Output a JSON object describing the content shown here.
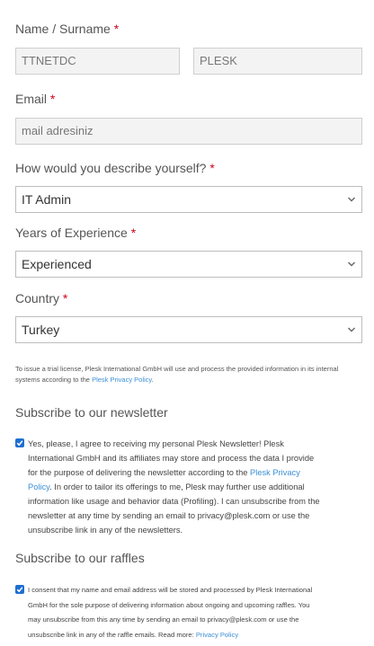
{
  "form": {
    "name_label": "Name / Surname",
    "required_mark": "*",
    "first_name_value": "TTNETDC",
    "last_name_value": "PLESK",
    "email_label": "Email",
    "email_placeholder": "mail adresiniz",
    "describe_label": "How would you describe yourself?",
    "describe_selected": "IT Admin",
    "experience_label": "Years of Experience",
    "experience_selected": "Experienced",
    "country_label": "Country",
    "country_selected": "Turkey",
    "notice_text": "To issue a trial license, Plesk International GmbH will use and process the provided information in its internal",
    "notice_text_2": "systems according to the",
    "notice_link": "Plesk Privacy Policy",
    "notice_end": "."
  },
  "newsletter": {
    "heading": "Subscribe to our newsletter",
    "checked": true,
    "line1": "Yes, please, I agree to receiving my personal Plesk Newsletter! Plesk",
    "line2": "International GmbH and its affiliates may store and process the data I provide",
    "line3": "for the purpose of delivering the newsletter according to the",
    "link_a": "Plesk Privacy",
    "link_b": "Policy",
    "line4": ". In order to tailor its offerings to me, Plesk may further use additional",
    "line5": "information like usage and behavior data (Profiling). I can unsubscribe from the",
    "line6": "newsletter at any time by sending an email to privacy@plesk.com or use the",
    "line7": "unsubscribe link in any of the newsletters."
  },
  "raffles": {
    "heading": "Subscribe to our raffles",
    "checked": true,
    "line1": "I consent that my name and email address will be stored and processed by Plesk International",
    "line2": "GmbH for the sole purpose of delivering information about ongoing and upcoming raffles. You",
    "line3": "may unsubscribe from this any time by sending an email to privacy@plesk.com or use the",
    "line4": "unsubscribe link in any of the raffle emails. Read more:",
    "link": "Privacy Policy"
  },
  "colors": {
    "required": "#d0021b",
    "link": "#3b8fd6",
    "checkbox": "#1f6fd0"
  },
  "icons": {
    "select_arrow": "chevron-down-icon",
    "checkbox": "checkmark-icon"
  }
}
